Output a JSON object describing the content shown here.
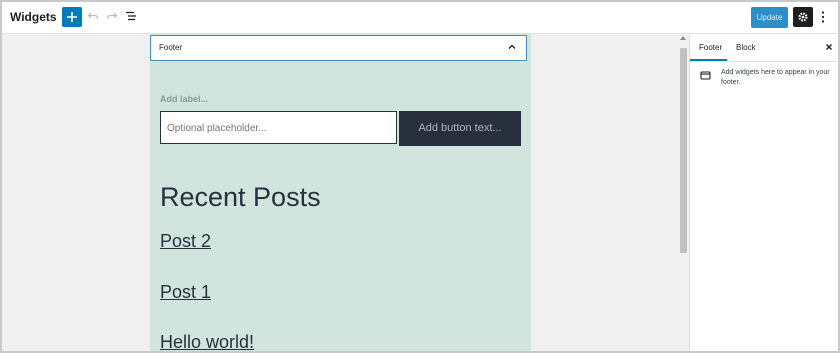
{
  "header": {
    "title": "Widgets",
    "update_label": "Update"
  },
  "widget_area": {
    "title": "Footer",
    "search": {
      "label": "Add label...",
      "placeholder": "Optional placeholder...",
      "button_label": "Add button text..."
    },
    "recent_posts": {
      "heading": "Recent Posts",
      "posts": [
        "Post 2",
        "Post 1",
        "Hello world!"
      ]
    }
  },
  "sidebar": {
    "tabs": [
      "Footer",
      "Block"
    ],
    "active_tab": "Footer",
    "description": "Add widgets here to appear in your footer."
  },
  "icons": {
    "add": "plus-icon",
    "undo": "undo-icon",
    "redo": "redo-icon",
    "list_view": "list-view-icon",
    "settings": "gear-icon",
    "more": "more-vertical-icon",
    "collapse": "chevron-up-icon",
    "close": "close-icon",
    "widget_area": "widget-area-icon"
  },
  "colors": {
    "accent": "#007cba",
    "widget_area_bg": "#d1e4dd",
    "dark": "#28303d"
  }
}
